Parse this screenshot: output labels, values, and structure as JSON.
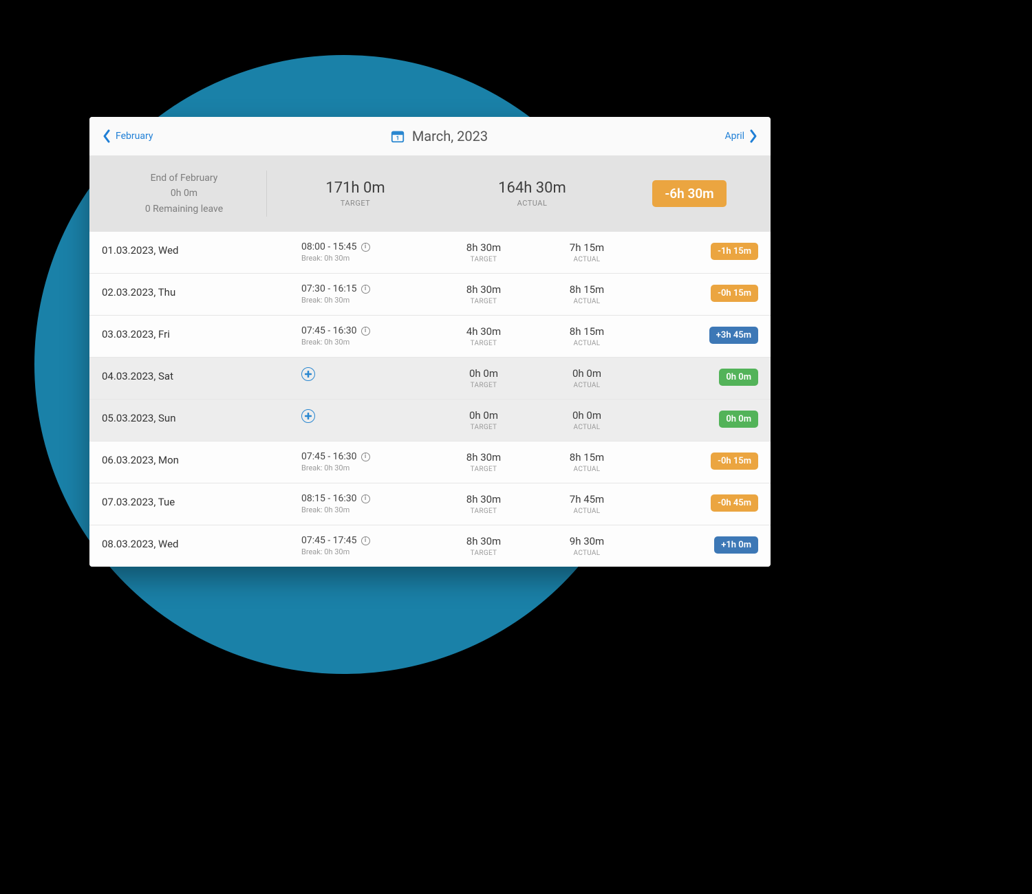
{
  "colors": {
    "negative": "#eba540",
    "positive": "#3d78b6",
    "neutral": "#53b359",
    "brand": "#1f7fd6"
  },
  "nav": {
    "prev": "February",
    "title": "March, 2023",
    "next": "April"
  },
  "summary": {
    "left_line1": "End of February",
    "left_line2": "0h 0m",
    "left_line3": "0 Remaining leave",
    "target_value": "171h 0m",
    "target_label": "TARGET",
    "actual_value": "164h 30m",
    "actual_label": "ACTUAL",
    "delta_value": "-6h 30m",
    "delta_kind": "negative"
  },
  "labels": {
    "target": "TARGET",
    "actual": "ACTUAL",
    "break_prefix": "Break: "
  },
  "rows": [
    {
      "date": "01.03.2023, Wed",
      "weekend": false,
      "time": "08:00 - 15:45",
      "break": "0h 30m",
      "target": "8h 30m",
      "actual": "7h 15m",
      "delta": "-1h 15m",
      "delta_kind": "negative"
    },
    {
      "date": "02.03.2023, Thu",
      "weekend": false,
      "time": "07:30 - 16:15",
      "break": "0h 30m",
      "target": "8h 30m",
      "actual": "8h 15m",
      "delta": "-0h 15m",
      "delta_kind": "negative"
    },
    {
      "date": "03.03.2023, Fri",
      "weekend": false,
      "time": "07:45 - 16:30",
      "break": "0h 30m",
      "target": "4h 30m",
      "actual": "8h 15m",
      "delta": "+3h 45m",
      "delta_kind": "positive"
    },
    {
      "date": "04.03.2023, Sat",
      "weekend": true,
      "time": "",
      "break": "",
      "target": "0h 0m",
      "actual": "0h 0m",
      "delta": "0h 0m",
      "delta_kind": "neutral"
    },
    {
      "date": "05.03.2023, Sun",
      "weekend": true,
      "time": "",
      "break": "",
      "target": "0h 0m",
      "actual": "0h 0m",
      "delta": "0h 0m",
      "delta_kind": "neutral"
    },
    {
      "date": "06.03.2023, Mon",
      "weekend": false,
      "time": "07:45 - 16:30",
      "break": "0h 30m",
      "target": "8h 30m",
      "actual": "8h 15m",
      "delta": "-0h 15m",
      "delta_kind": "negative"
    },
    {
      "date": "07.03.2023, Tue",
      "weekend": false,
      "time": "08:15 - 16:30",
      "break": "0h 30m",
      "target": "8h 30m",
      "actual": "7h 45m",
      "delta": "-0h 45m",
      "delta_kind": "negative"
    },
    {
      "date": "08.03.2023, Wed",
      "weekend": false,
      "time": "07:45 - 17:45",
      "break": "0h 30m",
      "target": "8h 30m",
      "actual": "9h 30m",
      "delta": "+1h 0m",
      "delta_kind": "positive"
    }
  ]
}
